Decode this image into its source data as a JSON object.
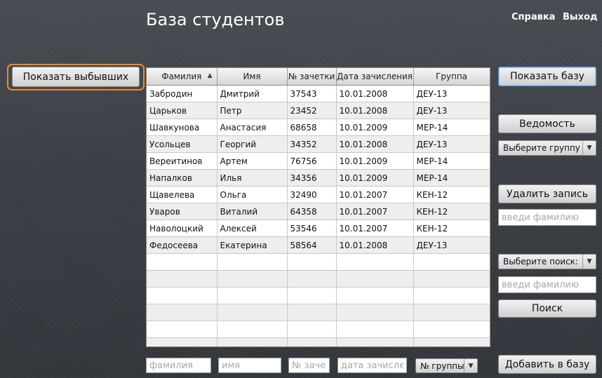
{
  "header": {
    "title": "База студентов",
    "help_link": "Справка",
    "exit_link": "Выход"
  },
  "left": {
    "show_dropped_button": "Показать выбывших",
    "highlight_color": "#ef8a2b"
  },
  "table": {
    "columns": [
      "Фамилия",
      "Имя",
      "№ зачетки",
      "Дата зачисления",
      "Группа"
    ],
    "sorted_column": "Фамилия",
    "sort_direction": "ascending",
    "rows": [
      [
        "Забродин",
        "Дмитрий",
        "37543",
        "10.01.2008",
        "ДЕУ-13"
      ],
      [
        "Царьков",
        "Петр",
        "23452",
        "10.01.2008",
        "ДЕУ-13"
      ],
      [
        "Шавкунова",
        "Анастасия",
        "68658",
        "10.01.2009",
        "МЕР-14"
      ],
      [
        "Усольцев",
        "Георгий",
        "34352",
        "10.01.2008",
        "ДЕУ-13"
      ],
      [
        "Вереитинов",
        "Артем",
        "76756",
        "10.01.2009",
        "МЕР-14"
      ],
      [
        "Напалков",
        "Илья",
        "34356",
        "10.01.2009",
        "МЕР-14"
      ],
      [
        "Щавелева",
        "Ольга",
        "32490",
        "10.01.2007",
        "КЕН-12"
      ],
      [
        "Уваров",
        "Виталий",
        "64358",
        "10.01.2007",
        "КЕН-12"
      ],
      [
        "Наволоцкий",
        "Алексей",
        "53546",
        "10.01.2007",
        "КЕН-12"
      ],
      [
        "Федосеева",
        "Екатерина",
        "58564",
        "10.01.2008",
        "ДЕУ-13"
      ]
    ],
    "empty_rows": 6
  },
  "add_row": {
    "lastname_placeholder": "фамилия",
    "firstname_placeholder": "имя",
    "record_placeholder": "№ зачетки",
    "date_placeholder": "дата зачисления",
    "group_select": "№ группы"
  },
  "right": {
    "show_base_button": "Показать базу",
    "statement_button": "Ведомость",
    "group_select": "Выберите группу",
    "delete_button": "Удалить запись",
    "delete_placeholder": "введи фамилию",
    "search_select": "Выберите поиск:",
    "search_placeholder": "введи фамилию",
    "search_button": "Поиск",
    "add_button": "Добавить в базу"
  }
}
